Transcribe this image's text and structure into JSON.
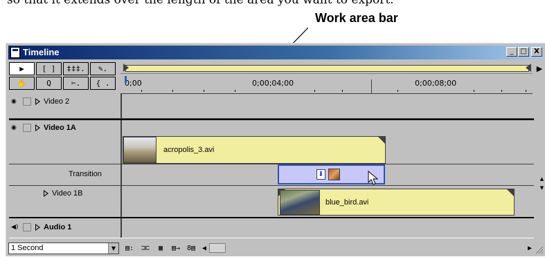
{
  "caption": {
    "partial_text": "so that it extends over the length of the area you want to export."
  },
  "callout": {
    "label": "Work area bar"
  },
  "window": {
    "title": "Timeline",
    "controls": {
      "minimize": "_",
      "maximize": "□",
      "close": "X"
    },
    "menu_arrow": "▶"
  },
  "tools": {
    "row1": [
      "▶",
      "[ ]",
      "‡‡‡.",
      "✎."
    ],
    "row2": [
      "✋",
      "Q",
      "✂.",
      "{ ."
    ]
  },
  "ruler": {
    "labels": [
      "0;00",
      "0;00;04;00",
      "0;00;08;00"
    ],
    "work_area_bar": {
      "color": "#f2eea0"
    }
  },
  "tracks": [
    {
      "name": "Video 2",
      "bold": false,
      "eye_icon": "eye-icon"
    },
    {
      "name": "Video 1A",
      "bold": true,
      "eye_icon": "eye-icon"
    },
    {
      "name": "Transition",
      "bold": false
    },
    {
      "name": "Video 1B",
      "bold": false
    },
    {
      "name": "Audio 1",
      "bold": true,
      "eye_icon": "speaker-icon"
    }
  ],
  "clips": {
    "video1a": {
      "label": "acropolis_3.avi",
      "color": "#f2eea0"
    },
    "transition": {
      "color": "#c8c8f8",
      "icon": "transition-icon"
    },
    "video1b": {
      "label": "blue_bird.avi",
      "color": "#f2eea0"
    }
  },
  "bottombar": {
    "time_scale": "1 Second",
    "icons": [
      "track-options-icon",
      "snap-icon",
      "toggle-edge-icon",
      "track-format-icon",
      "shift-icon",
      "sync-icon"
    ]
  }
}
